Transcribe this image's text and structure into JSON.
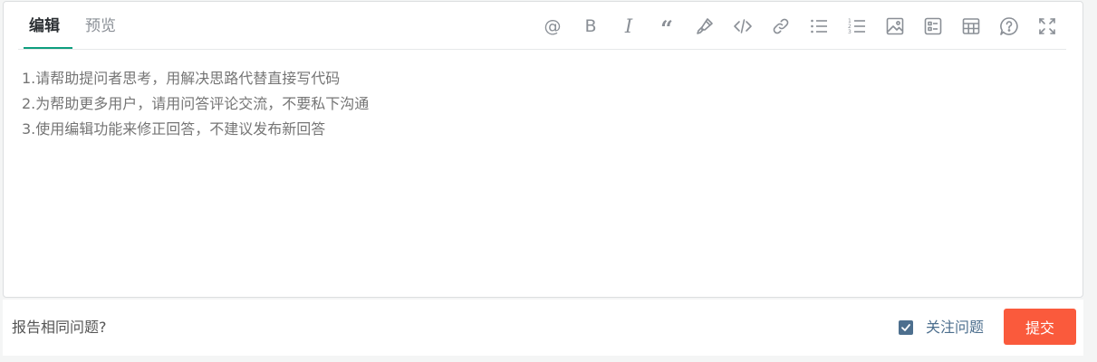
{
  "tabs": {
    "edit": "编辑",
    "preview": "预览"
  },
  "toolbar": {
    "mention": "@",
    "bold": "B",
    "italic": "I",
    "quote": "“"
  },
  "editor": {
    "placeholder": "1.请帮助提问者思考，用解决思路代替直接写代码\n2.为帮助更多用户，请用问答评论交流，不要私下沟通\n3.使用编辑功能来修正回答，不建议发布新回答"
  },
  "footer": {
    "report_label": "报告相同问题?",
    "follow_label": "关注问题",
    "follow_checked": true,
    "submit_label": "提交"
  },
  "colors": {
    "accent_tab": "#0e9e7e",
    "submit_bg": "#fa5a3c",
    "checkbox": "#4d6f8e"
  }
}
